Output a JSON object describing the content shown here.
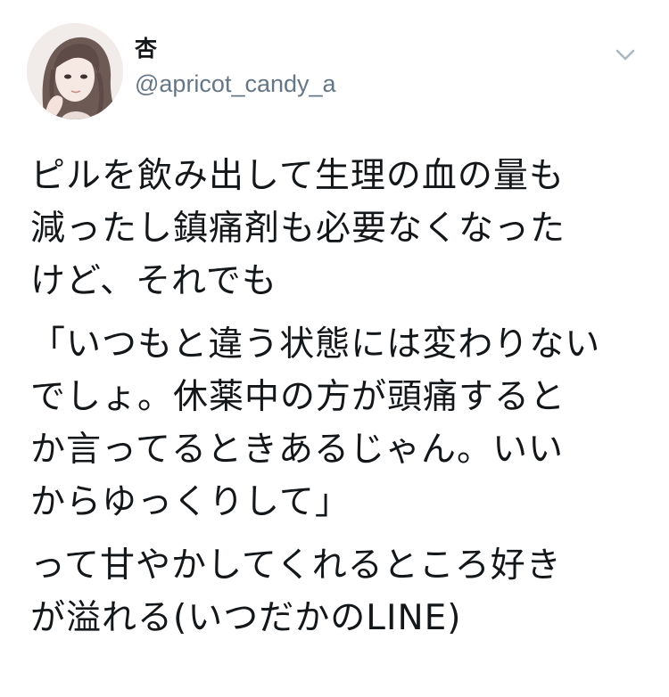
{
  "tweet": {
    "author": {
      "name": "杏",
      "handle": "@apricot_candy_a"
    },
    "menu_icon": "chevron-down-icon",
    "paragraphs": [
      {
        "lines": [
          "ピルを飲み出して生理の血の量も",
          "減ったし鎮痛剤も必要なくなった",
          "けど、それでも"
        ]
      },
      {
        "lines": [
          "「いつもと違う状態には変わりない",
          "でしょ。休薬中の方が頭痛すると",
          "か言ってるときあるじゃん。いい",
          "からゆっくりして」"
        ]
      },
      {
        "lines": [
          "って甘やかしてくれるところ好き",
          "が溢れる(いつだかのLINE)"
        ]
      }
    ]
  },
  "colors": {
    "text": "#14171a",
    "secondary_text": "#657786",
    "icon": "#aab8c2"
  }
}
